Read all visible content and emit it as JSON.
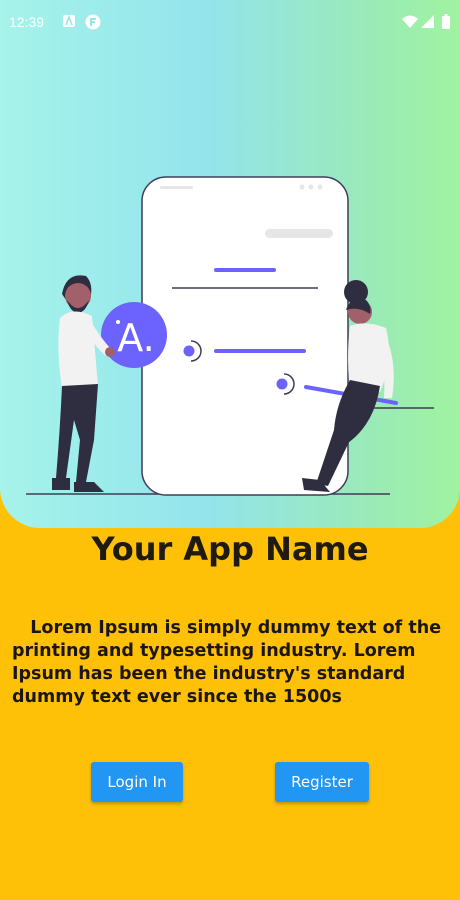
{
  "status_bar": {
    "time": "12:39"
  },
  "illustration": {
    "badge_letter": "A."
  },
  "main": {
    "app_name": "Your App Name",
    "description": "   Lorem Ipsum is simply dummy text of the printing and typesetting industry. Lorem Ipsum has been the industry's standard dummy text ever since the 1500s"
  },
  "buttons": {
    "login_label": "Login In",
    "register_label": "Register"
  },
  "colors": {
    "background": "#FFC107",
    "button": "#2196F3",
    "accent": "#6C63FF"
  }
}
